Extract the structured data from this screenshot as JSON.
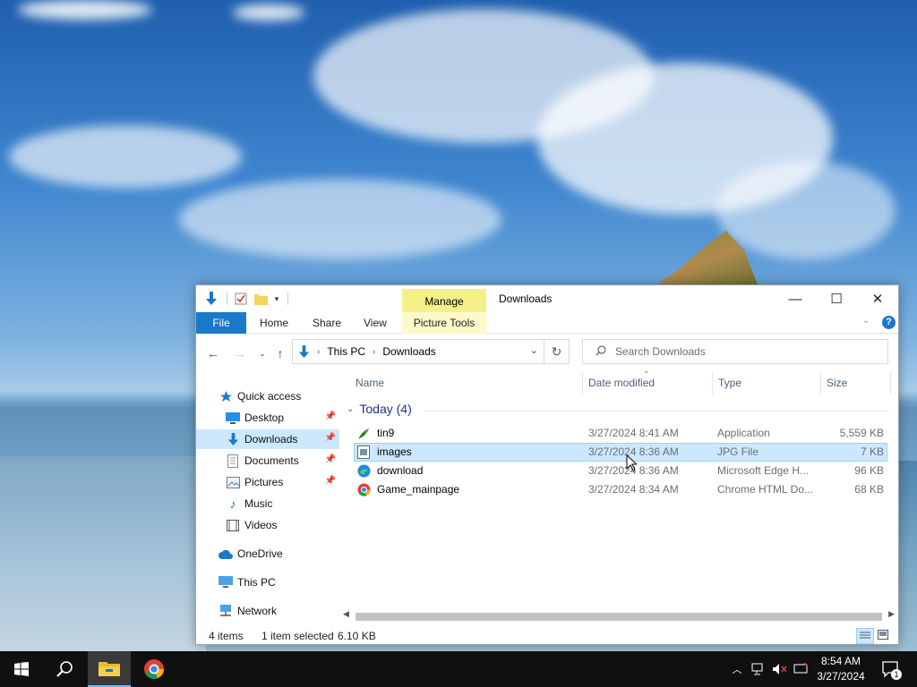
{
  "window": {
    "title": "Downloads",
    "contextual_tab_group": "Manage",
    "minimize_glyph": "—",
    "maximize_glyph": "☐",
    "close_glyph": "✕"
  },
  "ribbon": {
    "tabs": [
      "File",
      "Home",
      "Share",
      "View",
      "Picture Tools"
    ],
    "accent_color": "#1979ca",
    "contextual_color": "#f6f08a"
  },
  "address_bar": {
    "breadcrumb": [
      "This PC",
      "Downloads"
    ],
    "search_placeholder": "Search Downloads"
  },
  "nav_pane": {
    "items": [
      {
        "label": "Quick access",
        "icon": "star-icon"
      },
      {
        "label": "Desktop",
        "icon": "desktop-icon",
        "pinned": true
      },
      {
        "label": "Downloads",
        "icon": "download-icon",
        "pinned": true,
        "selected": true
      },
      {
        "label": "Documents",
        "icon": "documents-icon",
        "pinned": true
      },
      {
        "label": "Pictures",
        "icon": "pictures-icon",
        "pinned": true
      },
      {
        "label": "Music",
        "icon": "music-icon"
      },
      {
        "label": "Videos",
        "icon": "videos-icon"
      },
      {
        "label": "OneDrive",
        "icon": "cloud-icon"
      },
      {
        "label": "This PC",
        "icon": "computer-icon"
      },
      {
        "label": "Network",
        "icon": "network-icon"
      }
    ]
  },
  "file_list": {
    "columns": [
      "Name",
      "Date modified",
      "Type",
      "Size"
    ],
    "group_label": "Today (4)",
    "files": [
      {
        "name": "tin9",
        "date": "3/27/2024 8:41 AM",
        "type": "Application",
        "size": "5,559 KB",
        "icon": "app-icon"
      },
      {
        "name": "images",
        "date": "3/27/2024 8:36 AM",
        "type": "JPG File",
        "size": "7 KB",
        "icon": "image-file-icon",
        "selected": true
      },
      {
        "name": "download",
        "date": "3/27/2024 8:36 AM",
        "type": "Microsoft Edge H...",
        "size": "96 KB",
        "icon": "edge-icon"
      },
      {
        "name": "Game_mainpage",
        "date": "3/27/2024 8:34 AM",
        "type": "Chrome HTML Do...",
        "size": "68 KB",
        "icon": "chrome-icon"
      }
    ]
  },
  "status_bar": {
    "item_count": "4 items",
    "selection": "1 item selected",
    "selection_size": "6.10 KB"
  },
  "taskbar": {
    "apps": [
      "start-icon",
      "search-icon",
      "file-explorer-icon",
      "chrome-icon"
    ],
    "clock_time": "8:54 AM",
    "clock_date": "3/27/2024",
    "notification_count": "1"
  }
}
